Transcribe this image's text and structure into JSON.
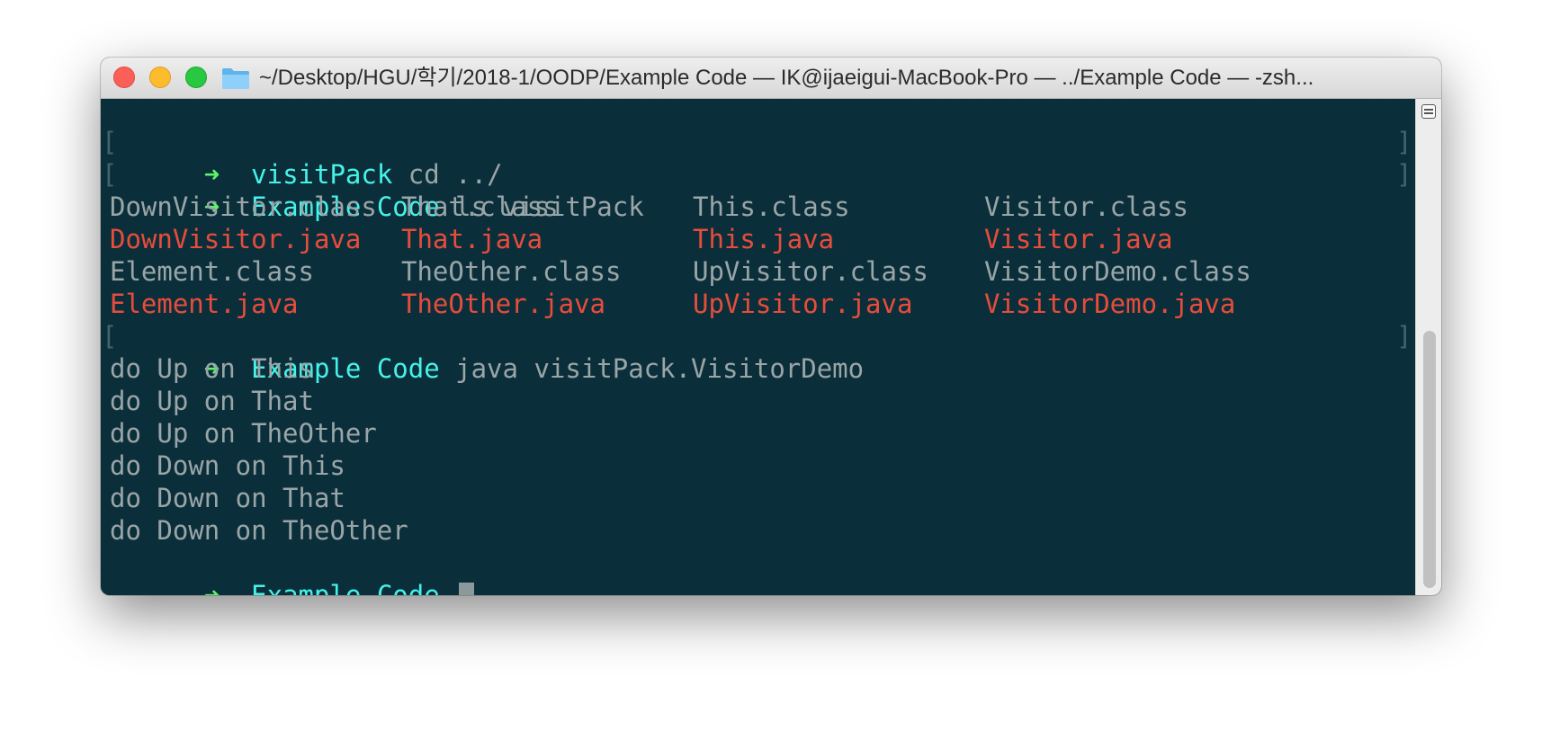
{
  "window": {
    "title": "~/Desktop/HGU/학기/2018-1/OODP/Example Code — IK@ijaeigui-MacBook-Pro — ../Example Code — -zsh..."
  },
  "colors": {
    "background": "#0b2f3a",
    "prompt_arrow": "#5ef36b",
    "directory": "#45f2e9",
    "text": "#9aa5a8",
    "java_file": "#e74c3c"
  },
  "terminal": {
    "prompt_symbol": "➜",
    "bracket_left": "[",
    "bracket_right": "]",
    "commands": [
      {
        "dir": "visitPack",
        "cmd": "cd ../"
      },
      {
        "dir": "Example Code",
        "cmd": "ls visitPack"
      },
      {
        "dir": "Example Code",
        "cmd": "java visitPack.VisitorDemo"
      }
    ],
    "ls_rows": [
      [
        "DownVisitor.class",
        "That.class",
        "This.class",
        "Visitor.class"
      ],
      [
        "DownVisitor.java",
        "That.java",
        "This.java",
        "Visitor.java"
      ],
      [
        "Element.class",
        "TheOther.class",
        "UpVisitor.class",
        "VisitorDemo.class"
      ],
      [
        "Element.java",
        "TheOther.java",
        "UpVisitor.java",
        "VisitorDemo.java"
      ]
    ],
    "output": [
      "do Up on This",
      "do Up on That",
      "do Up on TheOther",
      "do Down on This",
      "do Down on That",
      "do Down on TheOther"
    ],
    "current_prompt": {
      "dir": "Example Code"
    }
  }
}
